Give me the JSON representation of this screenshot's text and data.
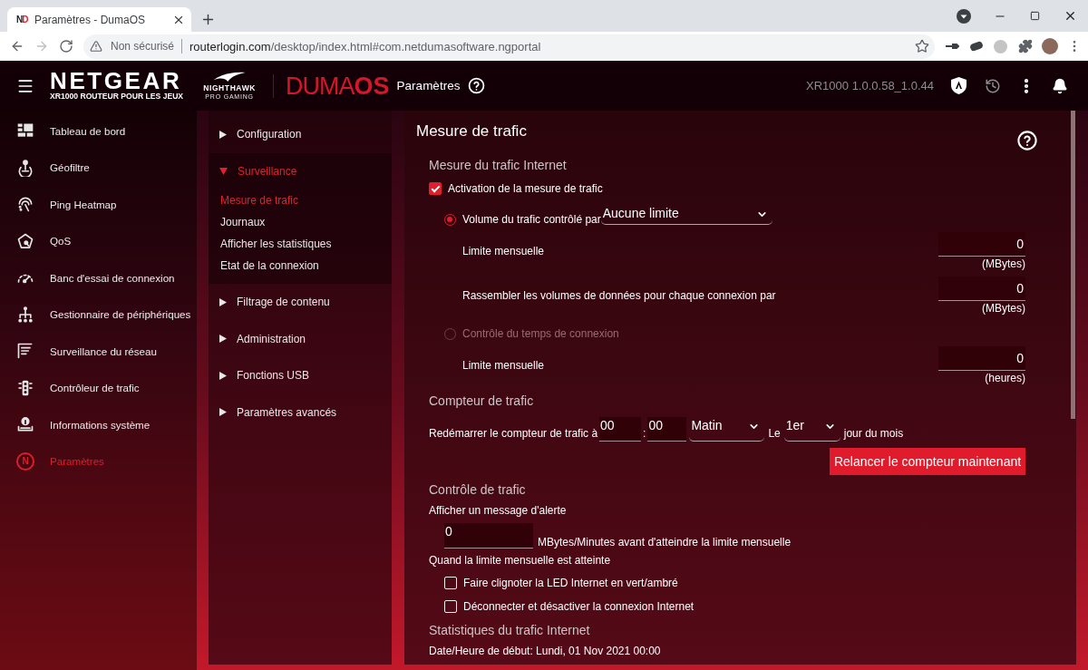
{
  "browser": {
    "favicon": "ND",
    "tab_title": "Paramètres - DumaOS",
    "security_label": "Non sécurisé",
    "url_host": "routerlogin.com",
    "url_path": "/desktop/index.html#com.netdumasoftware.ngportal"
  },
  "header": {
    "brand": "NETGEAR",
    "tagline": "XR1000 ROUTEUR POUR LES JEUX",
    "sub_brand": "NIGHTHAWK",
    "sub_brand_tagline": "PRO GAMING",
    "os_name": "DUMA",
    "os_suffix": "OS",
    "page_title": "Paramètres",
    "version": "XR1000 1.0.0.58_1.0.44"
  },
  "sidebar": {
    "items": [
      {
        "kind": "dashboard",
        "label": "Tableau de bord",
        "selected": false
      },
      {
        "kind": "geofilter",
        "label": "Géofiltre",
        "selected": false
      },
      {
        "kind": "ping",
        "label": "Ping Heatmap",
        "selected": false
      },
      {
        "kind": "qos",
        "label": "QoS",
        "selected": false
      },
      {
        "kind": "speedtest",
        "label": "Banc d'essai de connexion",
        "selected": false
      },
      {
        "kind": "devices",
        "label": "Gestionnaire de périphériques",
        "selected": false
      },
      {
        "kind": "monitor",
        "label": "Surveillance du réseau",
        "selected": false
      },
      {
        "kind": "traffic",
        "label": "Contrôleur de trafic",
        "selected": false
      },
      {
        "kind": "info",
        "label": "Informations système",
        "selected": false
      },
      {
        "kind": "logo",
        "glyph": "N",
        "label": "Paramètres",
        "selected": true
      }
    ]
  },
  "settings_nav": {
    "sections": [
      {
        "label": "Configuration",
        "expanded": false
      },
      {
        "label": "Surveillance",
        "expanded": true,
        "children": [
          {
            "label": "Mesure de trafic",
            "selected": true
          },
          {
            "label": "Journaux",
            "selected": false
          },
          {
            "label": "Afficher les statistiques",
            "selected": false
          },
          {
            "label": "Etat de la connexion",
            "selected": false
          }
        ]
      },
      {
        "label": "Filtrage de contenu",
        "expanded": false
      },
      {
        "label": "Administration",
        "expanded": false
      },
      {
        "label": "Fonctions USB",
        "expanded": false
      },
      {
        "label": "Paramètres avancés",
        "expanded": false
      }
    ]
  },
  "traffic_meter": {
    "title": "Mesure de trafic",
    "rows": [
      {
        "kind": "heading",
        "text": "Mesure du trafic Internet"
      },
      {
        "kind": "checkbox",
        "label": "Activation de la mesure de trafic",
        "checked": true,
        "children": [
          {
            "kind": "radio",
            "label": "Volume du trafic contrôlé par",
            "selected": true,
            "disabled": false,
            "select": "Aucune limite",
            "children": [
              {
                "kind": "limit",
                "label": "Limite mensuelle",
                "value": "0",
                "unit": "(MBytes)"
              },
              {
                "kind": "limit",
                "label": "Rassembler les volumes de données pour chaque connexion par",
                "value": "0",
                "unit": "(MBytes)"
              }
            ]
          },
          {
            "kind": "radio",
            "label": "Contrôle du temps de connexion",
            "selected": false,
            "disabled": true,
            "children": [
              {
                "kind": "limit",
                "label": "Limite mensuelle",
                "value": "0",
                "unit": "(heures)"
              }
            ]
          }
        ]
      },
      {
        "kind": "heading",
        "text": "Compteur de trafic"
      },
      {
        "kind": "restart",
        "label": "Redémarrer le compteur de trafic à",
        "hour": "00",
        "separator": ":",
        "minute": "00",
        "period": "Matin",
        "day_label": "Le",
        "day": "1er",
        "suffix": "jour du mois"
      },
      {
        "kind": "button",
        "label": "Relancer le compteur maintenant"
      },
      {
        "kind": "heading",
        "text": "Contrôle de trafic"
      },
      {
        "kind": "text",
        "text": "Afficher un message d'alerte",
        "children": [
          {
            "kind": "alert",
            "value": "0",
            "suffix": "MBytes/Minutes avant d'atteindre la limite mensuelle"
          }
        ]
      },
      {
        "kind": "text",
        "text": "Quand la limite mensuelle est atteinte",
        "children": [
          {
            "kind": "checkbox",
            "label": "Faire clignoter la LED Internet en vert/ambré",
            "checked": false
          },
          {
            "kind": "checkbox",
            "label": "Déconnecter et désactiver la connexion Internet",
            "checked": false
          }
        ]
      },
      {
        "kind": "heading",
        "text": "Statistiques du trafic Internet"
      },
      {
        "kind": "text",
        "text": "Date/Heure de début: Lundi, 01 Nov 2021 00:00"
      }
    ]
  }
}
